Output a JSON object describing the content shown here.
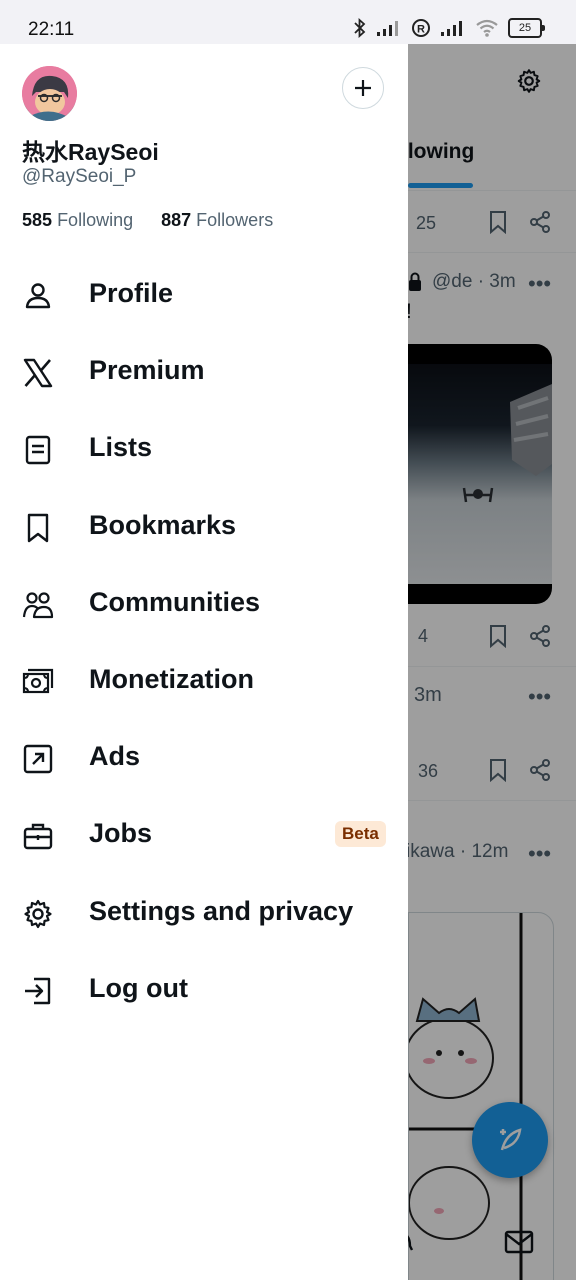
{
  "status_bar": {
    "time": "22:11",
    "battery": "25"
  },
  "profile": {
    "display_name": "热水RaySeoi",
    "handle": "@RaySeoi_P",
    "following_count": "585",
    "following_label": "Following",
    "followers_count": "887",
    "followers_label": "Followers"
  },
  "menu": {
    "items": [
      {
        "label": "Profile",
        "icon": "person-icon"
      },
      {
        "label": "Premium",
        "icon": "x-logo-icon"
      },
      {
        "label": "Lists",
        "icon": "list-icon"
      },
      {
        "label": "Bookmarks",
        "icon": "bookmark-icon"
      },
      {
        "label": "Communities",
        "icon": "communities-icon"
      },
      {
        "label": "Monetization",
        "icon": "money-icon"
      },
      {
        "label": "Ads",
        "icon": "ads-icon"
      },
      {
        "label": "Jobs",
        "icon": "briefcase-icon",
        "badge": "Beta"
      },
      {
        "label": "Settings and privacy",
        "icon": "gear-icon"
      },
      {
        "label": "Log out",
        "icon": "logout-icon"
      }
    ]
  },
  "background": {
    "tab_label": "llowing",
    "post1": {
      "count": "25"
    },
    "post2": {
      "meta": "@de · 3m",
      "text": "!",
      "count": "4"
    },
    "post3": {
      "meta": "3m",
      "count": "36"
    },
    "post4": {
      "meta": "ikawa · 12m"
    }
  },
  "colors": {
    "accent": "#1d9bf0",
    "text": "#0f1419",
    "muted": "#536471",
    "beta_bg": "#fde9d6",
    "beta_text": "#7a2e00"
  }
}
